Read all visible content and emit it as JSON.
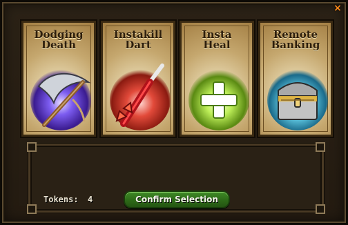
{
  "window": {
    "close_symbol": "×",
    "close_color": "#ff8a1a"
  },
  "cards": [
    {
      "title_line1": "Dodging",
      "title_line2": "Death",
      "icon": "scythe-icon",
      "glow_color": "#5a3bd6"
    },
    {
      "title_line1": "Instakill",
      "title_line2": "Dart",
      "icon": "dart-icon",
      "glow_color": "#d33a2a"
    },
    {
      "title_line1": "Insta",
      "title_line2": "Heal",
      "icon": "heal-cross-icon",
      "glow_color": "#8fd020"
    },
    {
      "title_line1": "Remote",
      "title_line2": "Banking",
      "icon": "treasure-chest-icon",
      "glow_color": "#4ac6e0"
    }
  ],
  "footer": {
    "tokens_label": "Tokens:",
    "tokens_value": "4",
    "confirm_label": "Confirm Selection",
    "confirm_color": "#2d6a18"
  }
}
